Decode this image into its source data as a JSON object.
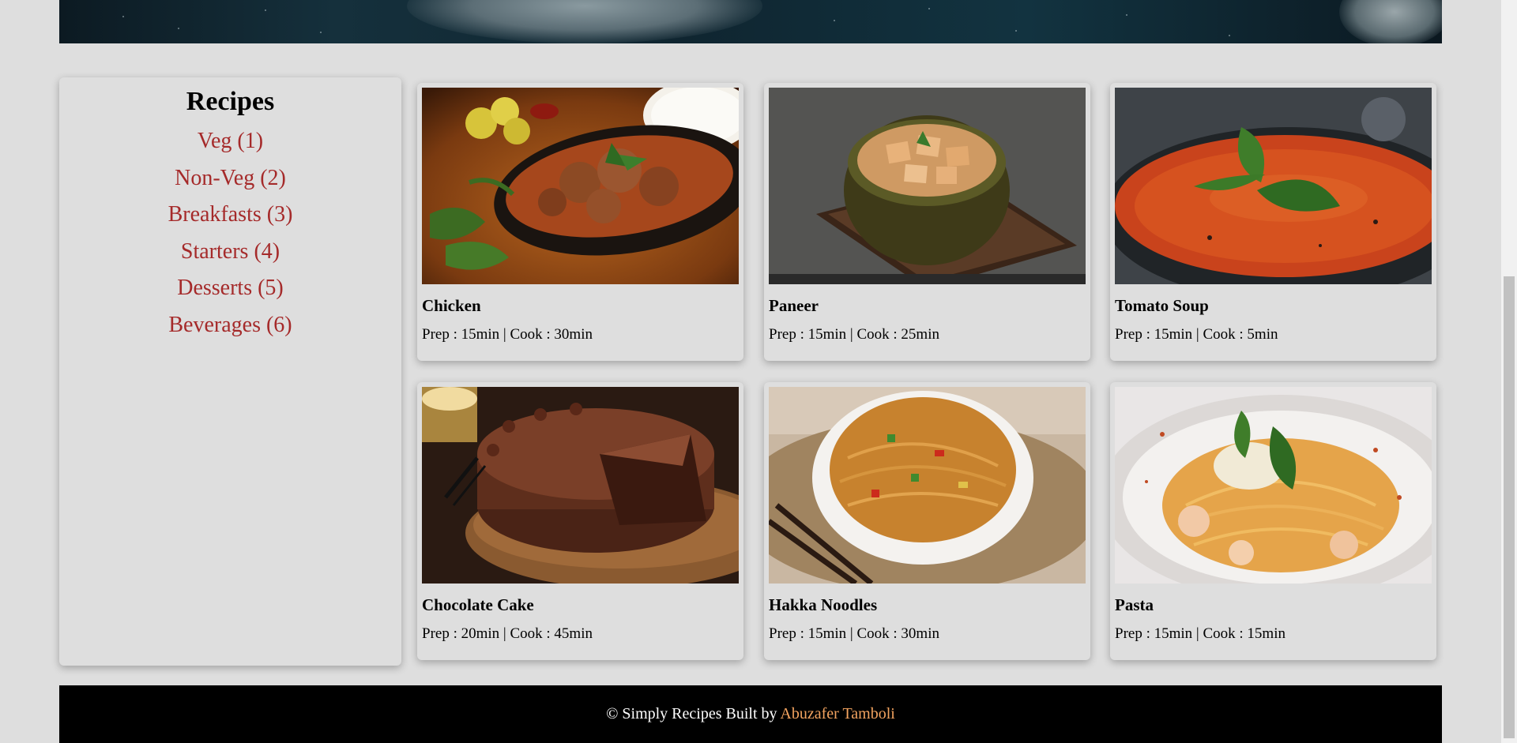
{
  "sidebar": {
    "title": "Recipes",
    "categories": [
      {
        "label": "Veg (1)"
      },
      {
        "label": "Non-Veg (2)"
      },
      {
        "label": "Breakfasts (3)"
      },
      {
        "label": "Starters (4)"
      },
      {
        "label": "Desserts (5)"
      },
      {
        "label": "Beverages (6)"
      }
    ]
  },
  "recipes": [
    {
      "name": "Chicken",
      "meta": "Prep : 15min | Cook : 30min",
      "image_icon": "chicken-curry-photo"
    },
    {
      "name": "Paneer",
      "meta": "Prep : 15min | Cook : 25min",
      "image_icon": "paneer-curry-photo"
    },
    {
      "name": "Tomato Soup",
      "meta": "Prep : 15min | Cook : 5min",
      "image_icon": "tomato-soup-photo"
    },
    {
      "name": "Chocolate Cake",
      "meta": "Prep : 20min | Cook : 45min",
      "image_icon": "chocolate-cake-photo"
    },
    {
      "name": "Hakka Noodles",
      "meta": "Prep : 15min | Cook : 30min",
      "image_icon": "hakka-noodles-photo"
    },
    {
      "name": "Pasta",
      "meta": "Prep : 15min | Cook : 15min",
      "image_icon": "pasta-photo"
    }
  ],
  "footer": {
    "prefix": "© Simply Recipes Built by ",
    "author": "Abuzafer Tamboli"
  },
  "colors": {
    "background": "#dedede",
    "link": "#a52a2a",
    "footer_bg": "#000000",
    "footer_author": "#f4a460"
  }
}
